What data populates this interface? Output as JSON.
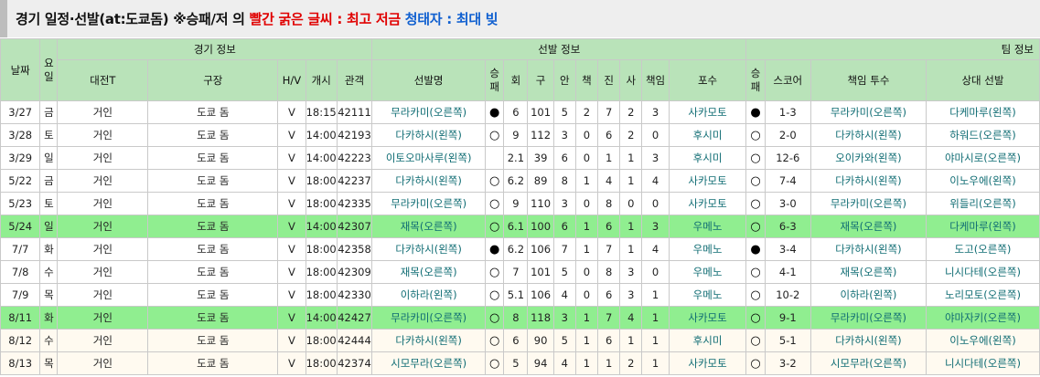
{
  "title": {
    "part1": "경기 일정·선발(at:도쿄돔) ※승패/저 의 ",
    "part2": "빨간 굵은 글씨 : 최고 저금",
    "part3": " 청태자 : 최대 빚"
  },
  "group_headers": {
    "date": "날짜",
    "game_info": "경기 정보",
    "starter_info": "선발 정보",
    "team_info": "팀 정보"
  },
  "columns": {
    "dow": [
      "요",
      "일"
    ],
    "opponent": "대전T",
    "stadium": "구장",
    "hv": "H/V",
    "start": "개시",
    "attendance": "관객",
    "starter": "선발명",
    "wl": [
      "승",
      "패"
    ],
    "ip": "회",
    "pitches": "구",
    "hits": "안",
    "er": "책",
    "walks": "진",
    "k": "사",
    "resp": "책임",
    "catcher": "포수",
    "twl": [
      "승",
      "패"
    ],
    "score": "스코어",
    "decision_pitcher": "책임 투수",
    "opp_starter": "상대 선발"
  },
  "rows": [
    {
      "date": "3/27",
      "dow": "금",
      "opp": "거인",
      "stadium": "도쿄 돔",
      "hv": "V",
      "time": "18:15",
      "att": "42111",
      "starter": "무라카미(오른쪽)",
      "wl": "●",
      "ip": "6",
      "pc": "101",
      "h": "5",
      "e": "2",
      "bb": "7",
      "so": "2",
      "r": "3",
      "catcher": "사카모토",
      "twl": "●",
      "score": "1-3",
      "dp": "무라카미(오른쪽)",
      "os": "다케마루(왼쪽)",
      "style": ""
    },
    {
      "date": "3/28",
      "dow": "토",
      "opp": "거인",
      "stadium": "도쿄 돔",
      "hv": "V",
      "time": "14:00",
      "att": "42193",
      "starter": "다카하시(왼쪽)",
      "wl": "○",
      "ip": "9",
      "pc": "112",
      "h": "3",
      "e": "0",
      "bb": "6",
      "so": "2",
      "r": "0",
      "catcher": "후시미",
      "twl": "○",
      "score": "2-0",
      "dp": "다카하시(왼쪽)",
      "os": "하워드(오른쪽)",
      "style": ""
    },
    {
      "date": "3/29",
      "dow": "일",
      "opp": "거인",
      "stadium": "도쿄 돔",
      "hv": "V",
      "time": "14:00",
      "att": "42223",
      "starter": "이토오마사루(왼쪽)",
      "wl": "",
      "ip": "2.1",
      "pc": "39",
      "h": "6",
      "e": "0",
      "bb": "1",
      "so": "1",
      "r": "3",
      "catcher": "후시미",
      "twl": "○",
      "score": "12-6",
      "dp": "오이카와(왼쪽)",
      "os": "야마시로(오른쪽)",
      "style": ""
    },
    {
      "date": "5/22",
      "dow": "금",
      "opp": "거인",
      "stadium": "도쿄 돔",
      "hv": "V",
      "time": "18:00",
      "att": "42237",
      "starter": "다카하시(왼쪽)",
      "wl": "○",
      "ip": "6.2",
      "pc": "89",
      "h": "8",
      "e": "1",
      "bb": "4",
      "so": "1",
      "r": "4",
      "catcher": "사카모토",
      "twl": "○",
      "score": "7-4",
      "dp": "다카하시(왼쪽)",
      "os": "이노우에(왼쪽)",
      "style": ""
    },
    {
      "date": "5/23",
      "dow": "토",
      "opp": "거인",
      "stadium": "도쿄 돔",
      "hv": "V",
      "time": "18:00",
      "att": "42335",
      "starter": "무라카미(오른쪽)",
      "wl": "○",
      "ip": "9",
      "pc": "110",
      "h": "3",
      "e": "0",
      "bb": "8",
      "so": "0",
      "r": "0",
      "catcher": "사카모토",
      "twl": "○",
      "score": "3-0",
      "dp": "무라카미(오른쪽)",
      "os": "위들리(오른쪽)",
      "style": ""
    },
    {
      "date": "5/24",
      "dow": "일",
      "opp": "거인",
      "stadium": "도쿄 돔",
      "hv": "V",
      "time": "14:00",
      "att": "42307",
      "starter": "재목(오른쪽)",
      "wl": "○",
      "ip": "6.1",
      "pc": "100",
      "h": "6",
      "e": "1",
      "bb": "6",
      "so": "1",
      "r": "3",
      "catcher": "우메노",
      "twl": "○",
      "score": "6-3",
      "dp": "재목(오른쪽)",
      "os": "다케마루(왼쪽)",
      "style": "hl"
    },
    {
      "date": "7/7",
      "dow": "화",
      "opp": "거인",
      "stadium": "도쿄 돔",
      "hv": "V",
      "time": "18:00",
      "att": "42358",
      "starter": "다카하시(왼쪽)",
      "wl": "●",
      "ip": "6.2",
      "pc": "106",
      "h": "7",
      "e": "1",
      "bb": "7",
      "so": "1",
      "r": "4",
      "catcher": "우메노",
      "twl": "●",
      "score": "3-4",
      "dp": "다카하시(왼쪽)",
      "os": "도고(오른쪽)",
      "style": ""
    },
    {
      "date": "7/8",
      "dow": "수",
      "opp": "거인",
      "stadium": "도쿄 돔",
      "hv": "V",
      "time": "18:00",
      "att": "42309",
      "starter": "재목(오른쪽)",
      "wl": "○",
      "ip": "7",
      "pc": "101",
      "h": "5",
      "e": "0",
      "bb": "8",
      "so": "3",
      "r": "0",
      "catcher": "우메노",
      "twl": "○",
      "score": "4-1",
      "dp": "재목(오른쪽)",
      "os": "니시다테(오른쪽)",
      "style": ""
    },
    {
      "date": "7/9",
      "dow": "목",
      "opp": "거인",
      "stadium": "도쿄 돔",
      "hv": "V",
      "time": "18:00",
      "att": "42330",
      "starter": "이하라(왼쪽)",
      "wl": "○",
      "ip": "5.1",
      "pc": "106",
      "h": "4",
      "e": "0",
      "bb": "6",
      "so": "3",
      "r": "1",
      "catcher": "우메노",
      "twl": "○",
      "score": "10-2",
      "dp": "이하라(왼쪽)",
      "os": "노리모토(오른쪽)",
      "style": ""
    },
    {
      "date": "8/11",
      "dow": "화",
      "opp": "거인",
      "stadium": "도쿄 돔",
      "hv": "V",
      "time": "14:00",
      "att": "42427",
      "starter": "무라카미(오른쪽)",
      "wl": "○",
      "ip": "8",
      "pc": "118",
      "h": "3",
      "e": "1",
      "bb": "7",
      "so": "4",
      "r": "1",
      "catcher": "사카모토",
      "twl": "○",
      "score": "9-1",
      "dp": "무라카미(오른쪽)",
      "os": "야마자키(오른쪽)",
      "style": "hl"
    },
    {
      "date": "8/12",
      "dow": "수",
      "opp": "거인",
      "stadium": "도쿄 돔",
      "hv": "V",
      "time": "18:00",
      "att": "42444",
      "starter": "다카하시(왼쪽)",
      "wl": "○",
      "ip": "6",
      "pc": "90",
      "h": "5",
      "e": "1",
      "bb": "6",
      "so": "1",
      "r": "1",
      "catcher": "후시미",
      "twl": "○",
      "score": "5-1",
      "dp": "다카하시(왼쪽)",
      "os": "이노우에(왼쪽)",
      "style": "cream"
    },
    {
      "date": "8/13",
      "dow": "목",
      "opp": "거인",
      "stadium": "도쿄 돔",
      "hv": "V",
      "time": "18:00",
      "att": "42374",
      "starter": "시모무라(오른쪽)",
      "wl": "○",
      "ip": "5",
      "pc": "94",
      "h": "4",
      "e": "1",
      "bb": "1",
      "so": "2",
      "r": "1",
      "catcher": "사카모토",
      "twl": "○",
      "score": "3-2",
      "dp": "시모무라(오른쪽)",
      "os": "니시다테(오른쪽)",
      "style": "cream"
    }
  ]
}
